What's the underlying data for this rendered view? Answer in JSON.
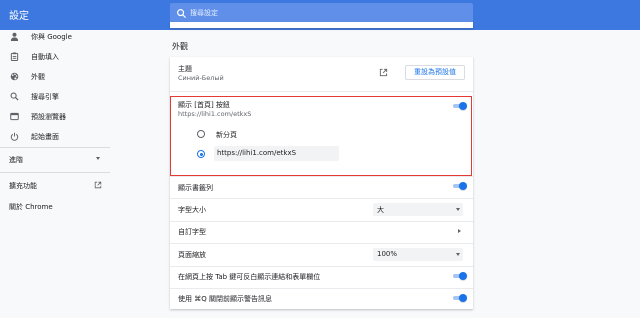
{
  "header": {
    "title": "設定",
    "search_placeholder": "搜尋設定"
  },
  "sidebar": {
    "items": [
      {
        "label": "你與 Google",
        "icon": "person-icon"
      },
      {
        "label": "自動填入",
        "icon": "clipboard-icon"
      },
      {
        "label": "外觀",
        "icon": "palette-icon"
      },
      {
        "label": "搜尋引擎",
        "icon": "search-icon"
      },
      {
        "label": "預設瀏覽器",
        "icon": "browser-icon"
      },
      {
        "label": "起始畫面",
        "icon": "power-icon"
      }
    ],
    "advanced_label": "進階",
    "extensions_label": "擴充功能",
    "about_label": "關於 Chrome"
  },
  "appearance": {
    "section_title": "外觀",
    "theme_label": "主題",
    "theme_value": "Синий-Белый",
    "reset_label": "重設為預設值",
    "home_button_label": "顯示 [首頁] 按鈕",
    "home_button_url": "https://lihi1.com/etkxS",
    "home_button_on": true,
    "radio_new_tab": "新分頁",
    "radio_url_value": "https://lihi1.com/etkxS",
    "selected_option": "custom-url",
    "bookmarks_bar_label": "顯示書籤列",
    "bookmarks_bar_on": true,
    "font_size_label": "字型大小",
    "font_size_value": "大",
    "custom_fonts_label": "自訂字型",
    "page_zoom_label": "頁面縮放",
    "page_zoom_value": "100%",
    "tab_highlight_label": "在網頁上按 Tab 鍵可反白顯示連結和表單欄位",
    "tab_highlight_on": true,
    "quit_warning_label": "使用 ⌘Q 關閉前顯示警告訊息",
    "quit_warning_on": true
  },
  "colors": {
    "header_blue": "#3c78e0",
    "accent": "#1a73e8",
    "highlight_border": "#e53935"
  }
}
